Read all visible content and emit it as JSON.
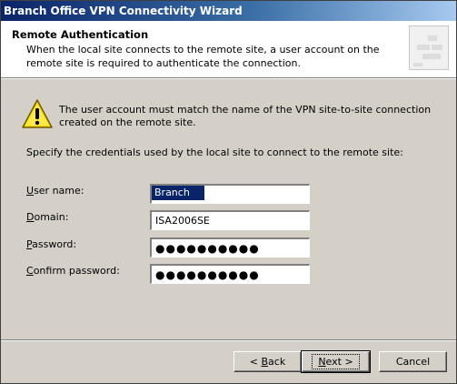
{
  "window": {
    "title": "Branch Office VPN Connectivity Wizard"
  },
  "header": {
    "title": "Remote Authentication",
    "description": "When the local site connects to the remote site, a user account on the remote site is required to authenticate the connection."
  },
  "warning": {
    "icon": "warning-icon",
    "text": "The user account must match the name of the VPN site-to-site connection created on the remote site."
  },
  "instructions": "Specify the credentials used by the local site to connect to the remote site:",
  "form": {
    "username": {
      "label_underlined": "U",
      "label_rest": "ser name:",
      "value": "Branch"
    },
    "domain": {
      "label_underlined": "D",
      "label_rest": "omain:",
      "value": "ISA2006SE"
    },
    "password": {
      "label_underlined": "P",
      "label_rest": "assword:",
      "masked": "●●●●●●●●●●"
    },
    "confirm": {
      "label_underlined": "C",
      "label_rest": "onfirm password:",
      "masked": "●●●●●●●●●●"
    }
  },
  "buttons": {
    "back_prefix": "< ",
    "back_underlined": "B",
    "back_rest": "ack",
    "next_underlined": "N",
    "next_rest": "ext >",
    "cancel": "Cancel"
  }
}
